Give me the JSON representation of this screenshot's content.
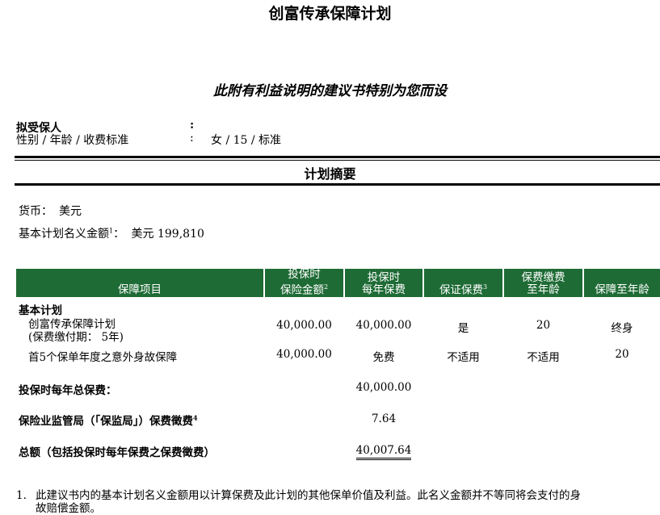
{
  "title": "创富传承保障计划",
  "subtitle": "此附有利益说明的建议书特别为您而设",
  "insured": {
    "label": "拟受保人",
    "colon1": ":",
    "sub_label": "性别 / 年龄 / 收费标准",
    "colon2": ":",
    "value": "女 / 15 / 标准"
  },
  "section_title": "计划摘要",
  "currency": {
    "label": "货币：",
    "value": "美元"
  },
  "basic_amount": {
    "label": "基本计划名义金额",
    "sup": "1",
    "suffix": "：",
    "value": "美元 199,810"
  },
  "table": {
    "headers": [
      {
        "lines": [
          "保障项目"
        ]
      },
      {
        "lines": [
          "投保时",
          "保险金额"
        ],
        "sup": "2"
      },
      {
        "lines": [
          "投保时",
          "每年保费"
        ]
      },
      {
        "lines": [
          "保证保费"
        ],
        "sup": "3"
      },
      {
        "lines": [
          "保费缴费",
          "至年龄"
        ]
      },
      {
        "lines": [
          "保障至年龄"
        ]
      }
    ],
    "group_label": "基本计划",
    "rows": [
      {
        "name_line1": "创富传承保障计划",
        "name_line2": "(保费缴付期： 5年)",
        "sum_insured": "40,000.00",
        "annual_premium": "40,000.00",
        "guaranteed": "是",
        "pay_to_age": "20",
        "cover_to_age": "终身"
      },
      {
        "name_line1": "首5个保单年度之意外身故保障",
        "sum_insured": "40,000.00",
        "annual_premium": "免费",
        "guaranteed": "不适用",
        "pay_to_age": "不适用",
        "cover_to_age": "20"
      }
    ],
    "total_annual_label": "投保时每年总保费：",
    "total_annual_value": "40,000.00",
    "levy_label": "保险业监管局（「保监局」）保费徵费",
    "levy_sup": "4",
    "levy_value": "7.64",
    "grand_total_label": "总额（包括投保时每年保费之保费徵费）",
    "grand_total_value": "40,007.64"
  },
  "footnote": {
    "number": "1.",
    "line1": "此建议书内的基本计划名义金额用以计算保费及此计划的其他保单价值及利益。此名义金额并不等同将会支付的身",
    "line2": "故赔偿金额。"
  },
  "colors": {
    "header_green": "#1e6b35"
  }
}
